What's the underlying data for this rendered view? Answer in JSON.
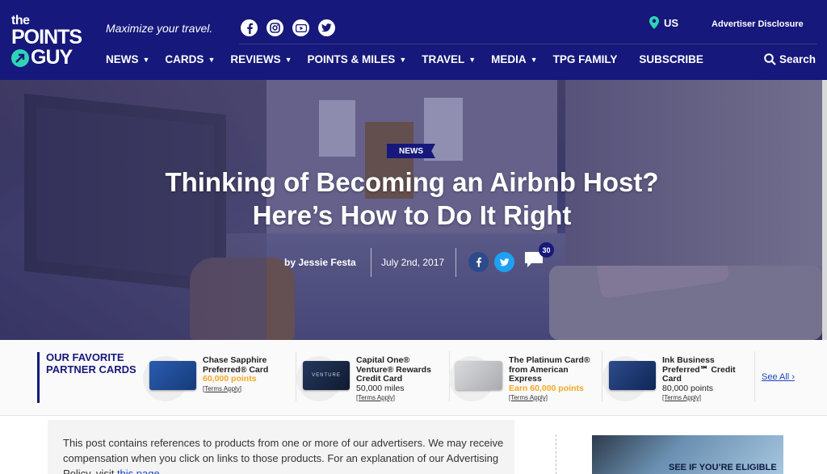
{
  "brand": {
    "line1": "the",
    "line2": "POINTS",
    "line3": "GUY"
  },
  "header": {
    "tagline": "Maximize your travel.",
    "socials": [
      "facebook-icon",
      "instagram-icon",
      "youtube-icon",
      "twitter-icon"
    ],
    "region": "US",
    "advertiser_disclosure": "Advertiser Disclosure",
    "search_label": "Search"
  },
  "nav": {
    "news": "NEWS",
    "cards": "CARDS",
    "reviews": "REVIEWS",
    "points_miles": "POINTS & MILES",
    "travel": "TRAVEL",
    "media": "MEDIA",
    "family": "TPG FAMILY",
    "subscribe": "SUBSCRIBE"
  },
  "article": {
    "category": "NEWS",
    "title": "Thinking of Becoming an Airbnb Host? Here’s How to Do It Right",
    "author": "by Jessie Festa",
    "date": "July 2nd, 2017",
    "comment_count": "30"
  },
  "partner_cards": {
    "heading_line1": "OUR FAVORITE",
    "heading_line2": "PARTNER CARDS",
    "see_all": "See All",
    "terms_label": "[Terms Apply]",
    "items": [
      {
        "name": "Chase Sapphire Preferred® Card",
        "offer": "60,000 points",
        "highlight": true,
        "color": "#1f4f9c"
      },
      {
        "name": "Capital One® Venture® Rewards Credit Card",
        "offer": "50,000 miles",
        "highlight": false,
        "color": "#1c2b4a",
        "card_label": "VENTURE"
      },
      {
        "name": "The Platinum Card® from American Express",
        "offer": "Earn 60,000 points",
        "highlight": true,
        "color": "#c8c9cb"
      },
      {
        "name": "Ink Business Preferred℠ Credit Card",
        "offer": "80,000 points",
        "highlight": false,
        "color": "#1d3d7c"
      }
    ]
  },
  "disclosure": {
    "text": "This post contains references to products from one or more of our advertisers. We may receive compensation when you click on links to those products. For an explanation of our Advertising Policy, visit ",
    "link": "this page"
  },
  "ad": {
    "text": "SEE IF YOU’RE ELIGIBLE"
  },
  "colors": {
    "brand_navy": "#16187b",
    "accent_teal": "#2fd4b4",
    "offer_orange": "#f5a623",
    "link_blue": "#1a44c4"
  }
}
